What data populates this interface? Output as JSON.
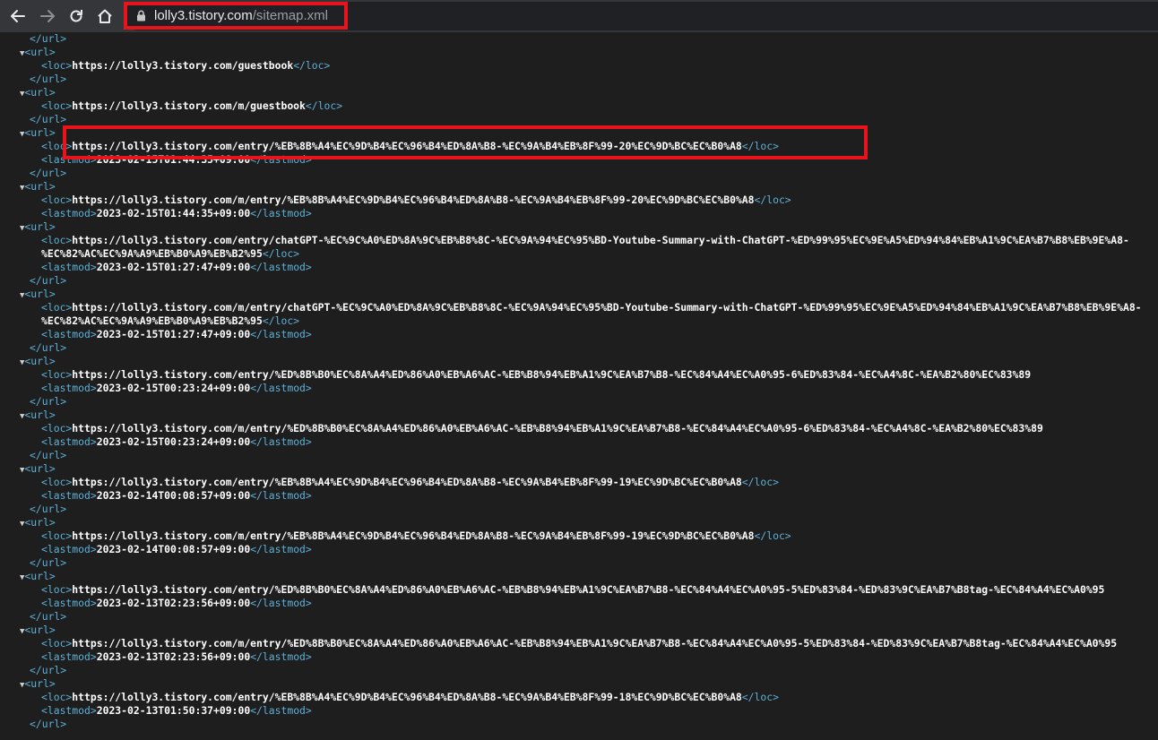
{
  "browser": {
    "url_host": "lolly3.tistory.com",
    "url_path": "/sitemap.xml",
    "back_icon": "arrow-left-icon",
    "forward_icon": "arrow-right-icon",
    "reload_icon": "reload-icon",
    "home_icon": "home-icon",
    "lock_icon": "lock-icon"
  },
  "colors": {
    "tag": "#5db0d7",
    "text": "#ffffff",
    "highlight": "#e8131b",
    "background": "#1e1e1e"
  },
  "xml_lines": [
    {
      "indent": 2,
      "text": "</url>"
    },
    {
      "indent": 1,
      "text": "<url>",
      "collapsible": true
    },
    {
      "indent": 3,
      "loc": "https://lolly3.tistory.com/guestbook"
    },
    {
      "indent": 2,
      "text": "</url>"
    },
    {
      "indent": 1,
      "text": "<url>",
      "collapsible": true
    },
    {
      "indent": 3,
      "loc": "https://lolly3.tistory.com/m/guestbook"
    },
    {
      "indent": 2,
      "text": "</url>"
    },
    {
      "indent": 1,
      "text": "<url>",
      "collapsible": true
    },
    {
      "indent": 3,
      "loc": "https://lolly3.tistory.com/entry/%EB%8B%A4%EC%9D%B4%EC%96%B4%ED%8A%B8-%EC%9A%B4%EB%8F%99-20%EC%9D%BC%EC%B0%A8"
    },
    {
      "indent": 3,
      "lastmod": "2023-02-15T01:44:35+09:00"
    },
    {
      "indent": 2,
      "text": "</url>"
    },
    {
      "indent": 1,
      "text": "<url>",
      "collapsible": true
    },
    {
      "indent": 3,
      "loc": "https://lolly3.tistory.com/m/entry/%EB%8B%A4%EC%9D%B4%EC%96%B4%ED%8A%B8-%EC%9A%B4%EB%8F%99-20%EC%9D%BC%EC%B0%A8"
    },
    {
      "indent": 3,
      "lastmod": "2023-02-15T01:44:35+09:00"
    },
    {
      "indent": 1,
      "text": "<url>",
      "collapsible": true
    },
    {
      "indent": 3,
      "loc": "https://lolly3.tistory.com/entry/chatGPT-%EC%9C%A0%ED%8A%9C%EB%B8%8C-%EC%9A%94%EC%95%BD-Youtube-Summary-with-ChatGPT-%ED%99%95%EC%9E%A5%ED%94%84%EB%A1%9C%EA%B7%B8%EB%9E%A8-",
      "loc_open_only": true
    },
    {
      "indent": 3,
      "text_cont": "%EC%82%AC%EC%9A%A9%EB%B0%A9%EB%B2%95",
      "close_loc": true
    },
    {
      "indent": 3,
      "lastmod": "2023-02-15T01:27:47+09:00"
    },
    {
      "indent": 2,
      "text": "</url>"
    },
    {
      "indent": 1,
      "text": "<url>",
      "collapsible": true
    },
    {
      "indent": 3,
      "loc": "https://lolly3.tistory.com/m/entry/chatGPT-%EC%9C%A0%ED%8A%9C%EB%B8%8C-%EC%9A%94%EC%95%BD-Youtube-Summary-with-ChatGPT-%ED%99%95%EC%9E%A5%ED%94%84%EB%A1%9C%EA%B7%B8%EB%9E%A8-",
      "loc_open_only": true
    },
    {
      "indent": 3,
      "text_cont": "%EC%82%AC%EC%9A%A9%EB%B0%A9%EB%B2%95",
      "close_loc": true
    },
    {
      "indent": 3,
      "lastmod": "2023-02-15T01:27:47+09:00"
    },
    {
      "indent": 2,
      "text": "</url>"
    },
    {
      "indent": 1,
      "text": "<url>",
      "collapsible": true
    },
    {
      "indent": 3,
      "loc": "https://lolly3.tistory.com/entry/%ED%8B%B0%EC%8A%A4%ED%86%A0%EB%A6%AC-%EB%B8%94%EB%A1%9C%EA%B7%B8-%EC%84%A4%EC%A0%95-6%ED%83%84-%EC%A4%8C-%EA%B2%80%EC%83%89",
      "loc_open_only": true
    },
    {
      "indent": 3,
      "lastmod": "2023-02-15T00:23:24+09:00"
    },
    {
      "indent": 2,
      "text": "</url>"
    },
    {
      "indent": 1,
      "text": "<url>",
      "collapsible": true
    },
    {
      "indent": 3,
      "loc": "https://lolly3.tistory.com/m/entry/%ED%8B%B0%EC%8A%A4%ED%86%A0%EB%A6%AC-%EB%B8%94%EB%A1%9C%EA%B7%B8-%EC%84%A4%EC%A0%95-6%ED%83%84-%EC%A4%8C-%EA%B2%80%EC%83%89",
      "loc_open_only": true
    },
    {
      "indent": 3,
      "lastmod": "2023-02-15T00:23:24+09:00"
    },
    {
      "indent": 2,
      "text": "</url>"
    },
    {
      "indent": 1,
      "text": "<url>",
      "collapsible": true
    },
    {
      "indent": 3,
      "loc": "https://lolly3.tistory.com/entry/%EB%8B%A4%EC%9D%B4%EC%96%B4%ED%8A%B8-%EC%9A%B4%EB%8F%99-19%EC%9D%BC%EC%B0%A8"
    },
    {
      "indent": 3,
      "lastmod": "2023-02-14T00:08:57+09:00"
    },
    {
      "indent": 2,
      "text": "</url>"
    },
    {
      "indent": 1,
      "text": "<url>",
      "collapsible": true
    },
    {
      "indent": 3,
      "loc": "https://lolly3.tistory.com/m/entry/%EB%8B%A4%EC%9D%B4%EC%96%B4%ED%8A%B8-%EC%9A%B4%EB%8F%99-19%EC%9D%BC%EC%B0%A8"
    },
    {
      "indent": 3,
      "lastmod": "2023-02-14T00:08:57+09:00"
    },
    {
      "indent": 2,
      "text": "</url>"
    },
    {
      "indent": 1,
      "text": "<url>",
      "collapsible": true
    },
    {
      "indent": 3,
      "loc": "https://lolly3.tistory.com/entry/%ED%8B%B0%EC%8A%A4%ED%86%A0%EB%A6%AC-%EB%B8%94%EB%A1%9C%EA%B7%B8-%EC%84%A4%EC%A0%95-5%ED%83%84-%ED%83%9C%EA%B7%B8tag-%EC%84%A4%EC%A0%95",
      "loc_open_only": true
    },
    {
      "indent": 3,
      "lastmod": "2023-02-13T02:23:56+09:00"
    },
    {
      "indent": 2,
      "text": "</url>"
    },
    {
      "indent": 1,
      "text": "<url>",
      "collapsible": true
    },
    {
      "indent": 3,
      "loc": "https://lolly3.tistory.com/m/entry/%ED%8B%B0%EC%8A%A4%ED%86%A0%EB%A6%AC-%EB%B8%94%EB%A1%9C%EA%B7%B8-%EC%84%A4%EC%A0%95-5%ED%83%84-%ED%83%9C%EA%B7%B8tag-%EC%84%A4%EC%A0%95",
      "loc_open_only": true
    },
    {
      "indent": 3,
      "lastmod": "2023-02-13T02:23:56+09:00"
    },
    {
      "indent": 2,
      "text": "</url>"
    },
    {
      "indent": 1,
      "text": "<url>",
      "collapsible": true
    },
    {
      "indent": 3,
      "loc": "https://lolly3.tistory.com/entry/%EB%8B%A4%EC%9D%B4%EC%96%B4%ED%8A%B8-%EC%9A%B4%EB%8F%99-18%EC%9D%BC%EC%B0%A8"
    },
    {
      "indent": 3,
      "lastmod": "2023-02-13T01:50:37+09:00"
    },
    {
      "indent": 2,
      "text": "</url>"
    }
  ]
}
